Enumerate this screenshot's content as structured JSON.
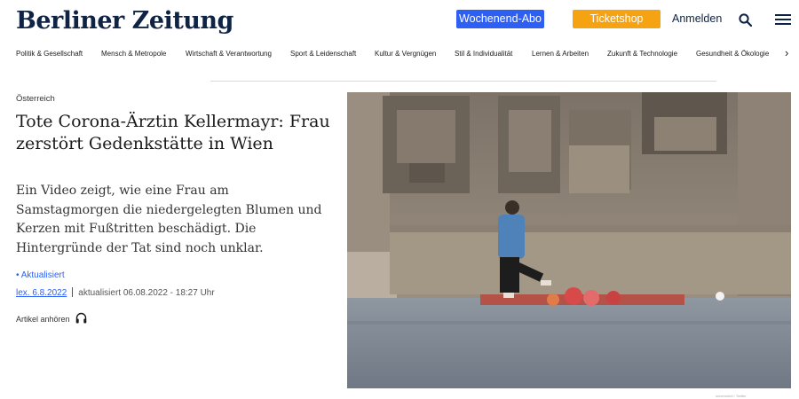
{
  "header": {
    "logo": "Berliner Zeitung",
    "abo_label": "Wochenend-Abo",
    "ticket_label": "Ticketshop",
    "login_label": "Anmelden",
    "icons": [
      "search-icon",
      "menu-icon"
    ],
    "colors": {
      "abo": "#2d5ff5",
      "ticket": "#f6a313",
      "brand": "#0f2344"
    }
  },
  "nav": {
    "items": [
      "Politik & Gesellschaft",
      "Mensch & Metropole",
      "Wirtschaft & Verantwortung",
      "Sport & Leidenschaft",
      "Kultur & Vergnügen",
      "Stil & Individualität",
      "Lernen & Arbeiten",
      "Zukunft & Technologie",
      "Gesundheit & Ökologie"
    ],
    "more_icon": "chevron-right-icon"
  },
  "article": {
    "kicker": "Österreich",
    "headline": "Tote Corona-Ärztin Kellermayr: Frau zerstört Gedenkstätte in Wien",
    "lead": "Ein Video zeigt, wie eine Frau am Samstagmorgen die niedergelegten Blumen und Kerzen mit Fußtritten beschädigt. Die Hintergründe der Tat sind noch unklar.",
    "updated_badge": "• Aktualisiert",
    "date_label": "lex. 6.8.2022",
    "updated_text": "aktualisiert 06.08.2022 - 18:27 Uhr",
    "listen_label": "Artikel anhören",
    "listen_icon": "headphone-icon"
  },
  "photo": {
    "credit": "screenshot / Twitter"
  }
}
